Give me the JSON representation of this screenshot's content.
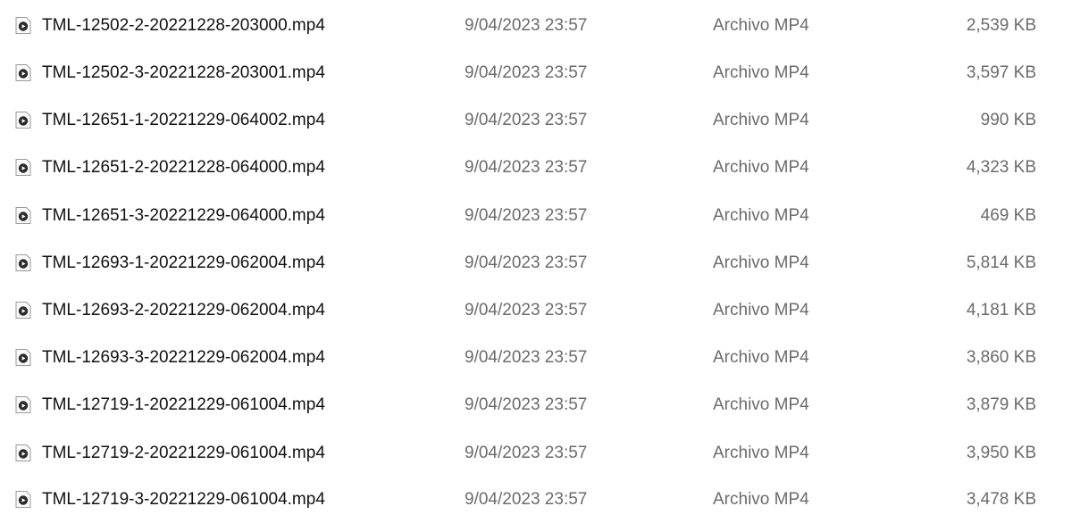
{
  "files": [
    {
      "name": "TML-12502-2-20221228-203000.mp4",
      "date": "9/04/2023 23:57",
      "type": "Archivo MP4",
      "size": "2,539 KB",
      "icon": "mp4-file-icon"
    },
    {
      "name": "TML-12502-3-20221228-203001.mp4",
      "date": "9/04/2023 23:57",
      "type": "Archivo MP4",
      "size": "3,597 KB",
      "icon": "mp4-file-icon"
    },
    {
      "name": "TML-12651-1-20221229-064002.mp4",
      "date": "9/04/2023 23:57",
      "type": "Archivo MP4",
      "size": "990 KB",
      "icon": "mp4-file-icon"
    },
    {
      "name": "TML-12651-2-20221228-064000.mp4",
      "date": "9/04/2023 23:57",
      "type": "Archivo MP4",
      "size": "4,323 KB",
      "icon": "mp4-file-icon"
    },
    {
      "name": "TML-12651-3-20221229-064000.mp4",
      "date": "9/04/2023 23:57",
      "type": "Archivo MP4",
      "size": "469 KB",
      "icon": "mp4-file-icon"
    },
    {
      "name": "TML-12693-1-20221229-062004.mp4",
      "date": "9/04/2023 23:57",
      "type": "Archivo MP4",
      "size": "5,814 KB",
      "icon": "mp4-file-icon"
    },
    {
      "name": "TML-12693-2-20221229-062004.mp4",
      "date": "9/04/2023 23:57",
      "type": "Archivo MP4",
      "size": "4,181 KB",
      "icon": "mp4-file-icon"
    },
    {
      "name": "TML-12693-3-20221229-062004.mp4",
      "date": "9/04/2023 23:57",
      "type": "Archivo MP4",
      "size": "3,860 KB",
      "icon": "mp4-file-icon"
    },
    {
      "name": "TML-12719-1-20221229-061004.mp4",
      "date": "9/04/2023 23:57",
      "type": "Archivo MP4",
      "size": "3,879 KB",
      "icon": "mp4-file-icon"
    },
    {
      "name": "TML-12719-2-20221229-061004.mp4",
      "date": "9/04/2023 23:57",
      "type": "Archivo MP4",
      "size": "3,950 KB",
      "icon": "mp4-file-icon"
    },
    {
      "name": "TML-12719-3-20221229-061004.mp4",
      "date": "9/04/2023 23:57",
      "type": "Archivo MP4",
      "size": "3,478 KB",
      "icon": "mp4-file-icon"
    }
  ]
}
